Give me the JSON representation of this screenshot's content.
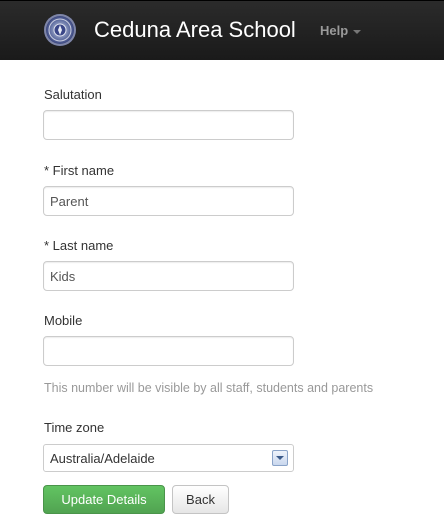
{
  "navbar": {
    "brand": "Ceduna Area School",
    "help_label": "Help"
  },
  "form": {
    "salutation": {
      "label": "Salutation",
      "value": ""
    },
    "first_name": {
      "label": "* First name",
      "value": "Parent"
    },
    "last_name": {
      "label": "* Last name",
      "value": "Kids"
    },
    "mobile": {
      "label": "Mobile",
      "value": "",
      "help_text": "This number will be visible by all staff, students and parents"
    },
    "time_zone": {
      "label": "Time zone",
      "selected": "Australia/Adelaide"
    }
  },
  "buttons": {
    "update": "Update Details",
    "back": "Back"
  },
  "colors": {
    "navbar_bg": "#1f1f1f",
    "primary_button": "#5bb75b",
    "help_text": "#999999"
  }
}
